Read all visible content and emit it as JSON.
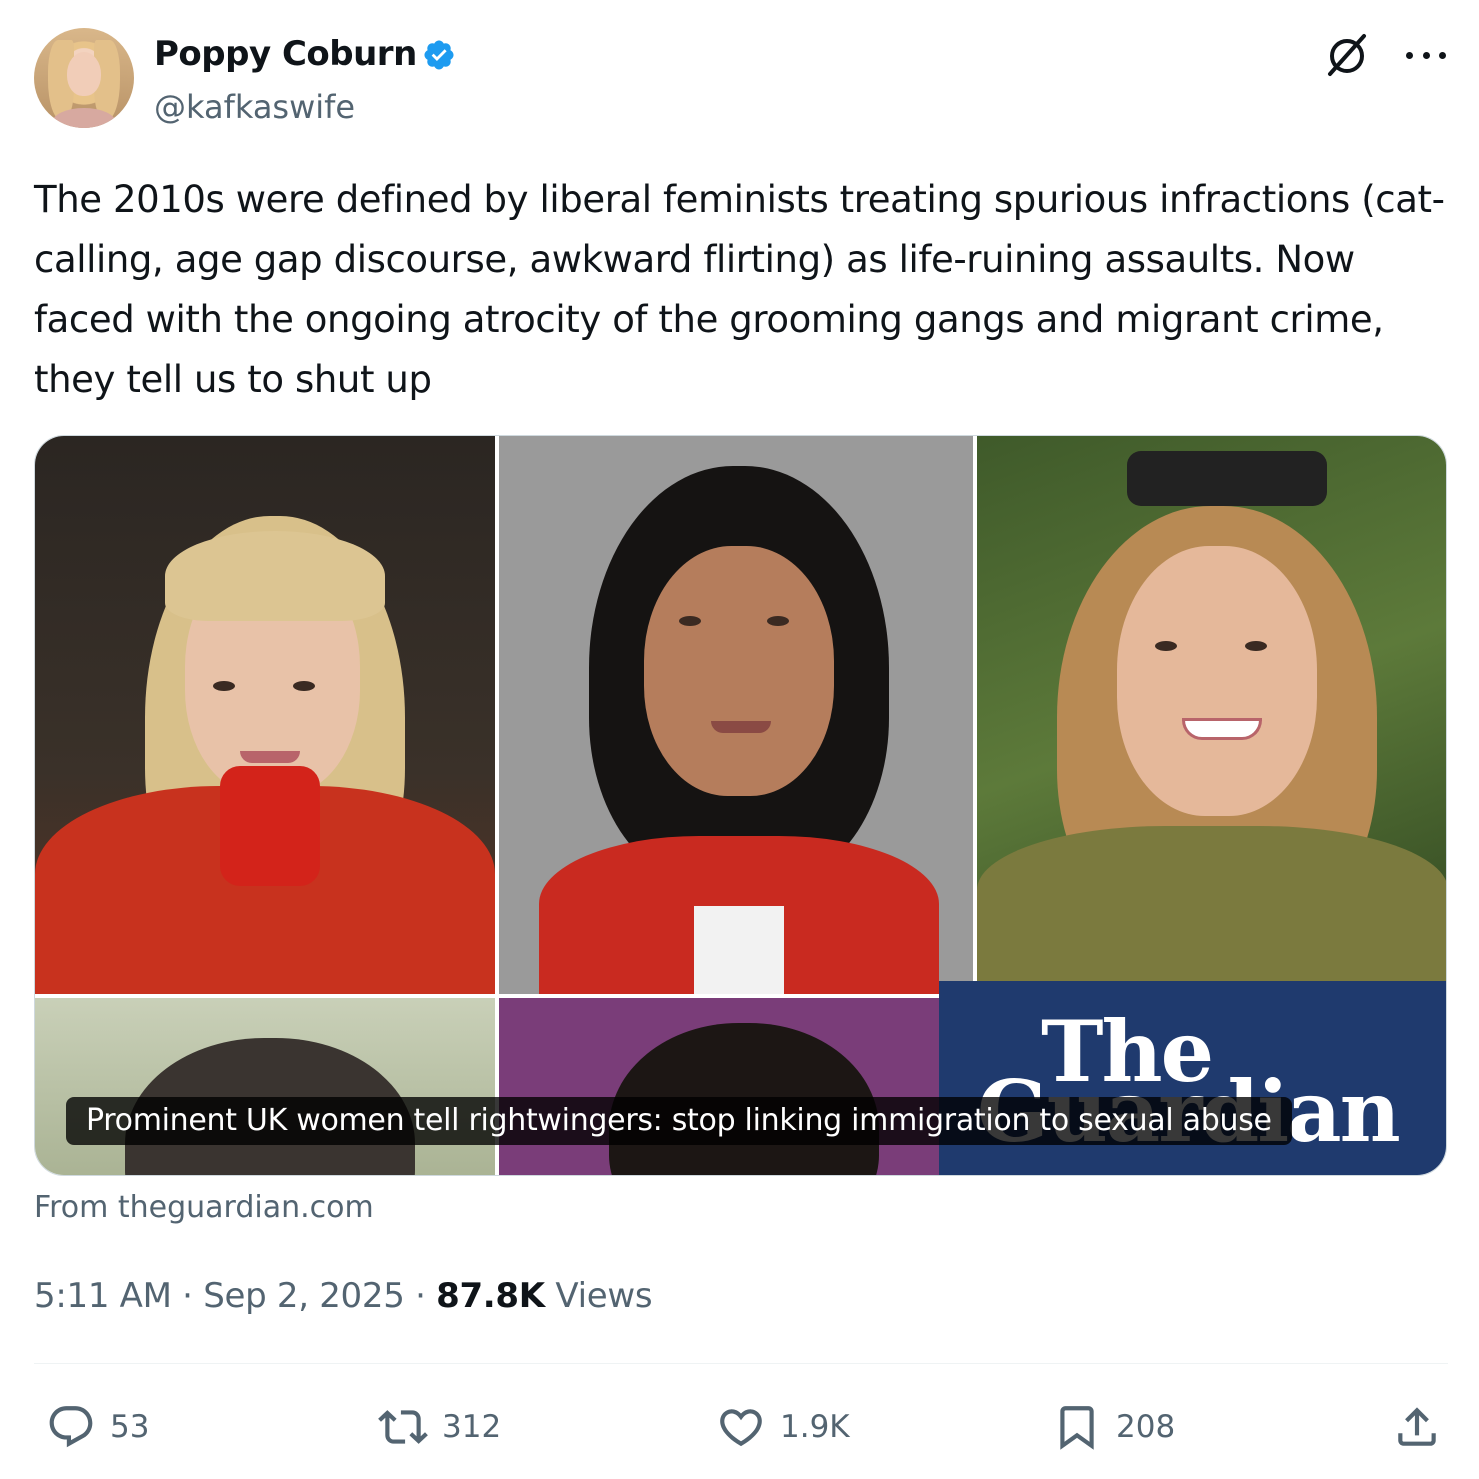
{
  "author": {
    "name": "Poppy Coburn",
    "handle": "@kafkaswife",
    "verified": true
  },
  "tweet": {
    "text": "The 2010s were defined by liberal feminists treating spurious infractions (cat-calling, age gap discourse, awkward flirting) as life-ruining assaults. Now faced with the ongoing atrocity of the grooming gangs and migrant crime, they tell us to shut up"
  },
  "card": {
    "logo_line1": "The",
    "logo_line2": "Guardian",
    "caption": "Prominent UK women tell rightwingers: stop linking immigration to sexual abuse",
    "source": "From theguardian.com"
  },
  "meta": {
    "time": "5:11 AM",
    "date": "Sep 2, 2025",
    "views_count": "87.8K",
    "views_label": "Views"
  },
  "actions": {
    "replies": "53",
    "reposts": "312",
    "likes": "1.9K",
    "bookmarks": "208"
  },
  "icons": {
    "verified": "verified-badge-icon",
    "grok": "grok-icon",
    "more": "more-icon",
    "reply": "reply-icon",
    "repost": "repost-icon",
    "like": "heart-icon",
    "bookmark": "bookmark-icon",
    "share": "share-icon"
  },
  "colors": {
    "verified_blue": "#1d9bf0",
    "text_primary": "#0f1419",
    "text_secondary": "#536471",
    "guardian_blue": "#1f3a6e"
  }
}
